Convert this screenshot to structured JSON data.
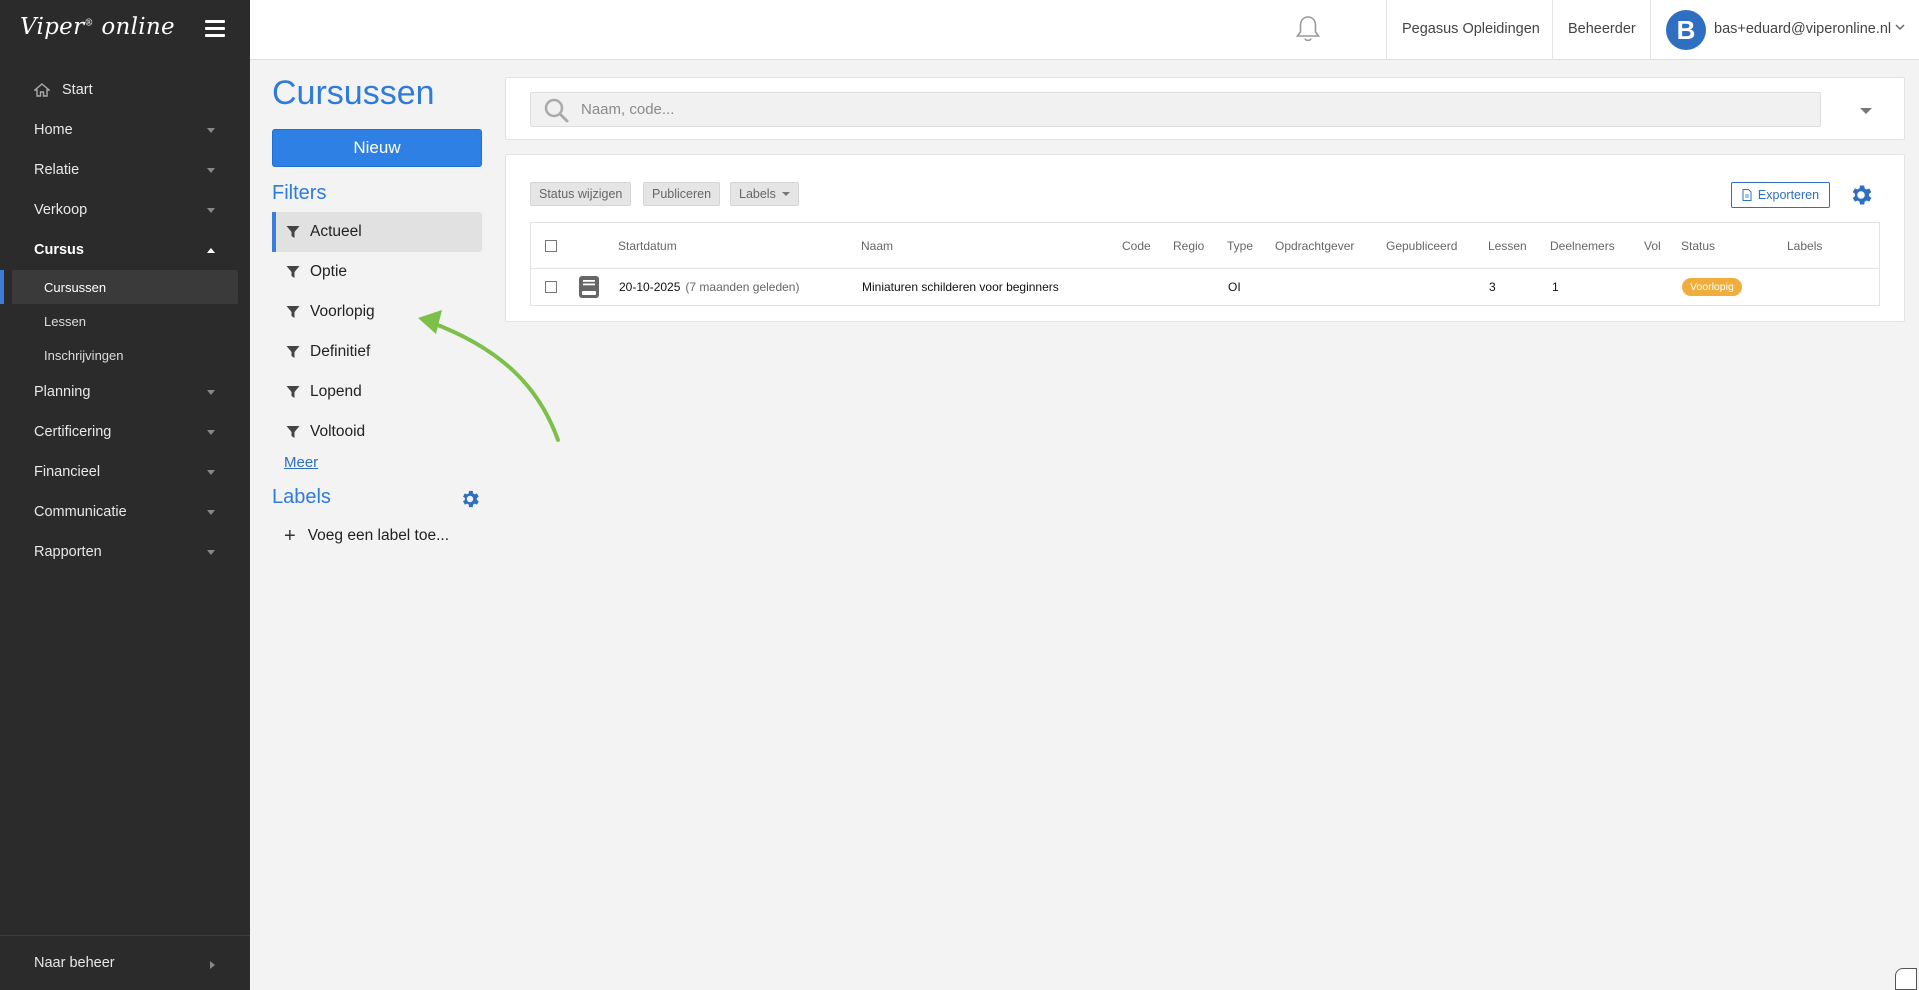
{
  "app": {
    "logo_text": "Viper",
    "logo_reg": "®",
    "logo_suffix": " online"
  },
  "sidebar": {
    "start_label": "Start",
    "items": [
      {
        "label": "Home"
      },
      {
        "label": "Relatie"
      },
      {
        "label": "Verkoop"
      },
      {
        "label": "Cursus",
        "open": true,
        "subitems": [
          {
            "label": "Cursussen",
            "active": true
          },
          {
            "label": "Lessen"
          },
          {
            "label": "Inschrijvingen"
          }
        ]
      },
      {
        "label": "Planning"
      },
      {
        "label": "Certificering"
      },
      {
        "label": "Financieel"
      },
      {
        "label": "Communicatie"
      },
      {
        "label": "Rapporten"
      }
    ],
    "footer_label": "Naar beheer"
  },
  "topbar": {
    "organization": "Pegasus Opleidingen",
    "role": "Beheerder",
    "avatar_letter": "B",
    "user_email": "bas+eduard@viperonline.nl"
  },
  "page": {
    "title": "Cursussen",
    "new_button": "Nieuw"
  },
  "filters": {
    "title": "Filters",
    "items": [
      {
        "label": "Actueel",
        "active": true
      },
      {
        "label": "Optie"
      },
      {
        "label": "Voorlopig"
      },
      {
        "label": "Definitief"
      },
      {
        "label": "Lopend"
      },
      {
        "label": "Voltooid"
      }
    ],
    "more_link": "Meer"
  },
  "labels": {
    "title": "Labels",
    "add_label": "Voeg een label toe..."
  },
  "search": {
    "placeholder": "Naam, code..."
  },
  "toolbar": {
    "status_button": "Status wijzigen",
    "publish_button": "Publiceren",
    "labels_button": "Labels",
    "export_button": "Exporteren"
  },
  "table": {
    "columns": [
      "Startdatum",
      "Naam",
      "Code",
      "Regio",
      "Type",
      "Opdrachtgever",
      "Gepubliceerd",
      "Lessen",
      "Deelnemers",
      "Vol",
      "Status",
      "Labels"
    ],
    "rows": [
      {
        "startdatum": "20-10-2025",
        "relative": "(7 maanden geleden)",
        "naam": "Miniaturen schilderen voor beginners",
        "code": "",
        "regio": "",
        "type": "OI",
        "opdrachtgever": "",
        "gepubliceerd": "",
        "lessen": "3",
        "deelnemers": "1",
        "vol": "",
        "status": "Voorlopig",
        "labels": ""
      }
    ]
  },
  "colors": {
    "accent": "#2f7bd8",
    "sidebar_bg": "#2b2b2b",
    "status_voorlopig": "#f0ad3c",
    "annotation_arrow": "#7cc04b"
  }
}
